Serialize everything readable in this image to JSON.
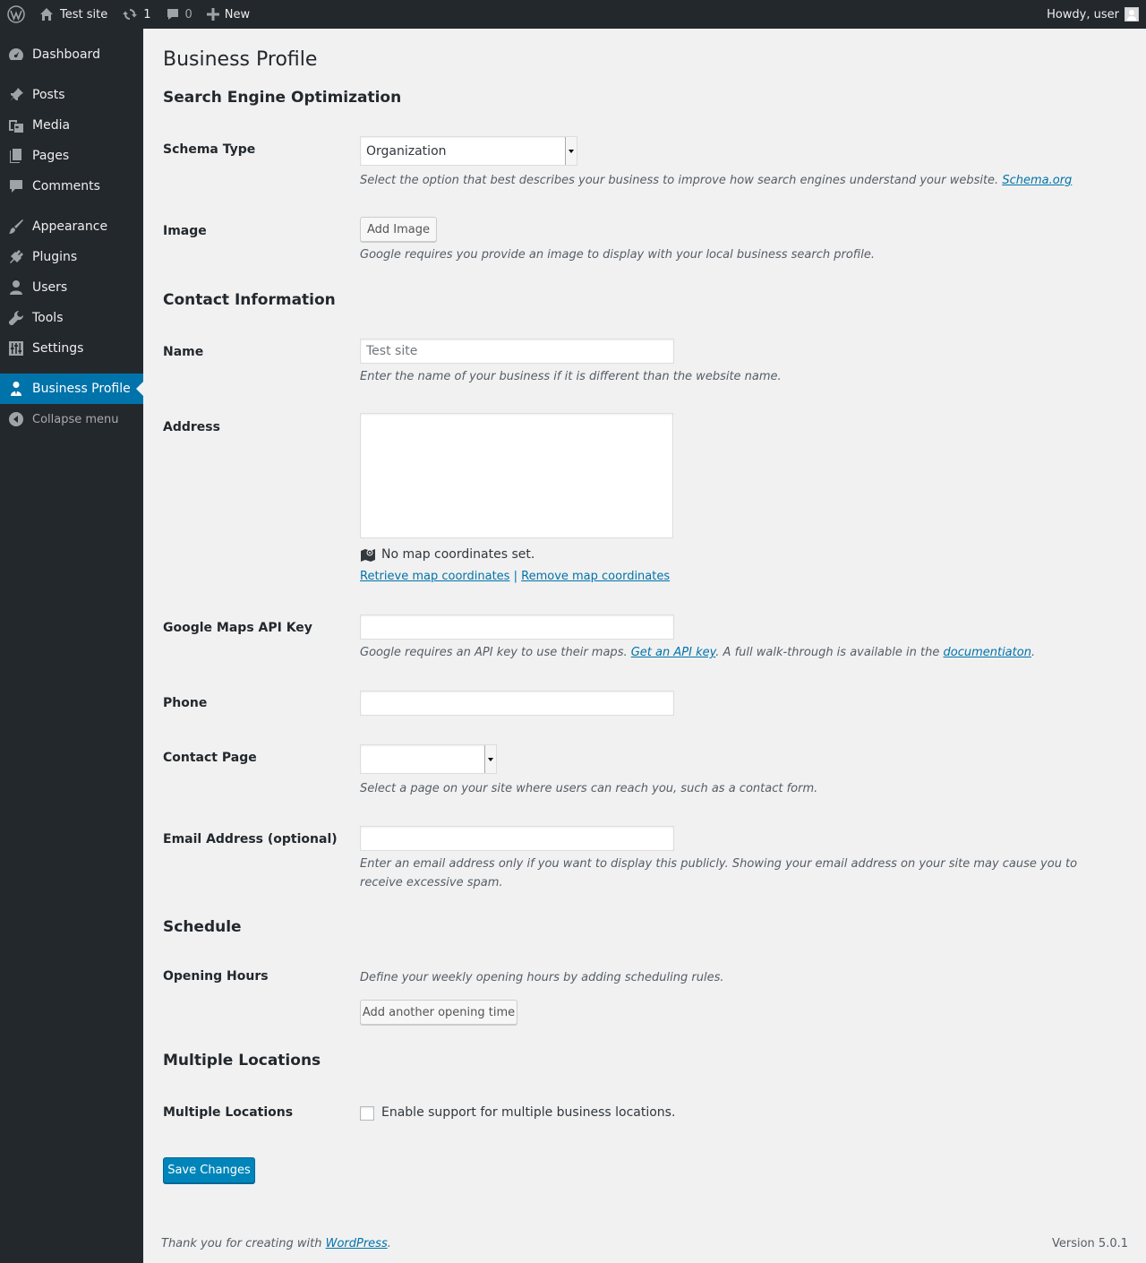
{
  "adminbar": {
    "site_name": "Test site",
    "updates_count": "1",
    "comments_count": "0",
    "new_label": "New",
    "howdy": "Howdy, user"
  },
  "sidebar": {
    "items": [
      {
        "label": "Dashboard",
        "icon": "dashboard-icon"
      },
      {
        "label": "Posts",
        "icon": "pin-icon"
      },
      {
        "label": "Media",
        "icon": "media-icon"
      },
      {
        "label": "Pages",
        "icon": "pages-icon"
      },
      {
        "label": "Comments",
        "icon": "comments-icon"
      },
      {
        "label": "Appearance",
        "icon": "paintbrush-icon"
      },
      {
        "label": "Plugins",
        "icon": "plugin-icon"
      },
      {
        "label": "Users",
        "icon": "users-icon"
      },
      {
        "label": "Tools",
        "icon": "wrench-icon"
      },
      {
        "label": "Settings",
        "icon": "settings-icon"
      },
      {
        "label": "Business Profile",
        "icon": "business-person-icon"
      }
    ],
    "collapse_label": "Collapse menu",
    "active_color": "#0073aa"
  },
  "page": {
    "title": "Business Profile",
    "sections": {
      "seo": "Search Engine Optimization",
      "contact": "Contact Information",
      "schedule": "Schedule",
      "locations": "Multiple Locations"
    },
    "schema_type": {
      "label": "Schema Type",
      "value": "Organization",
      "desc": "Select the option that best describes your business to improve how search engines understand your website.",
      "link": "Schema.org"
    },
    "image": {
      "label": "Image",
      "button": "Add Image",
      "desc": "Google requires you provide an image to display with your local business search profile."
    },
    "name": {
      "label": "Name",
      "placeholder": "Test site",
      "desc": "Enter the name of your business if it is different than the website name."
    },
    "address": {
      "label": "Address",
      "value": "",
      "map_status": "No map coordinates set.",
      "retrieve_link": "Retrieve map coordinates",
      "separator": "|",
      "remove_link": "Remove map coordinates"
    },
    "maps_api": {
      "label": "Google Maps API Key",
      "value": "",
      "desc_1": "Google requires an API key to use their maps.",
      "link_1": "Get an API key",
      "desc_2": ". A full walk-through is available in the",
      "link_2": "documentiaton",
      "desc_3": "."
    },
    "phone": {
      "label": "Phone",
      "value": ""
    },
    "contact_page": {
      "label": "Contact Page",
      "value": "",
      "desc": "Select a page on your site where users can reach you, such as a contact form."
    },
    "email": {
      "label": "Email Address (optional)",
      "value": "",
      "desc": "Enter an email address only if you want to display this publicly. Showing your email address on your site may cause you to receive excessive spam."
    },
    "opening_hours": {
      "label": "Opening Hours",
      "desc": "Define your weekly opening hours by adding scheduling rules.",
      "button": "Add another opening time"
    },
    "multiple_locations": {
      "label": "Multiple Locations",
      "checkbox_label": "Enable support for multiple business locations.",
      "checked": false
    },
    "save_button": "Save Changes"
  },
  "footer": {
    "thanks": "Thank you for creating with",
    "link": "WordPress",
    "period": ".",
    "version": "Version 5.0.1"
  }
}
